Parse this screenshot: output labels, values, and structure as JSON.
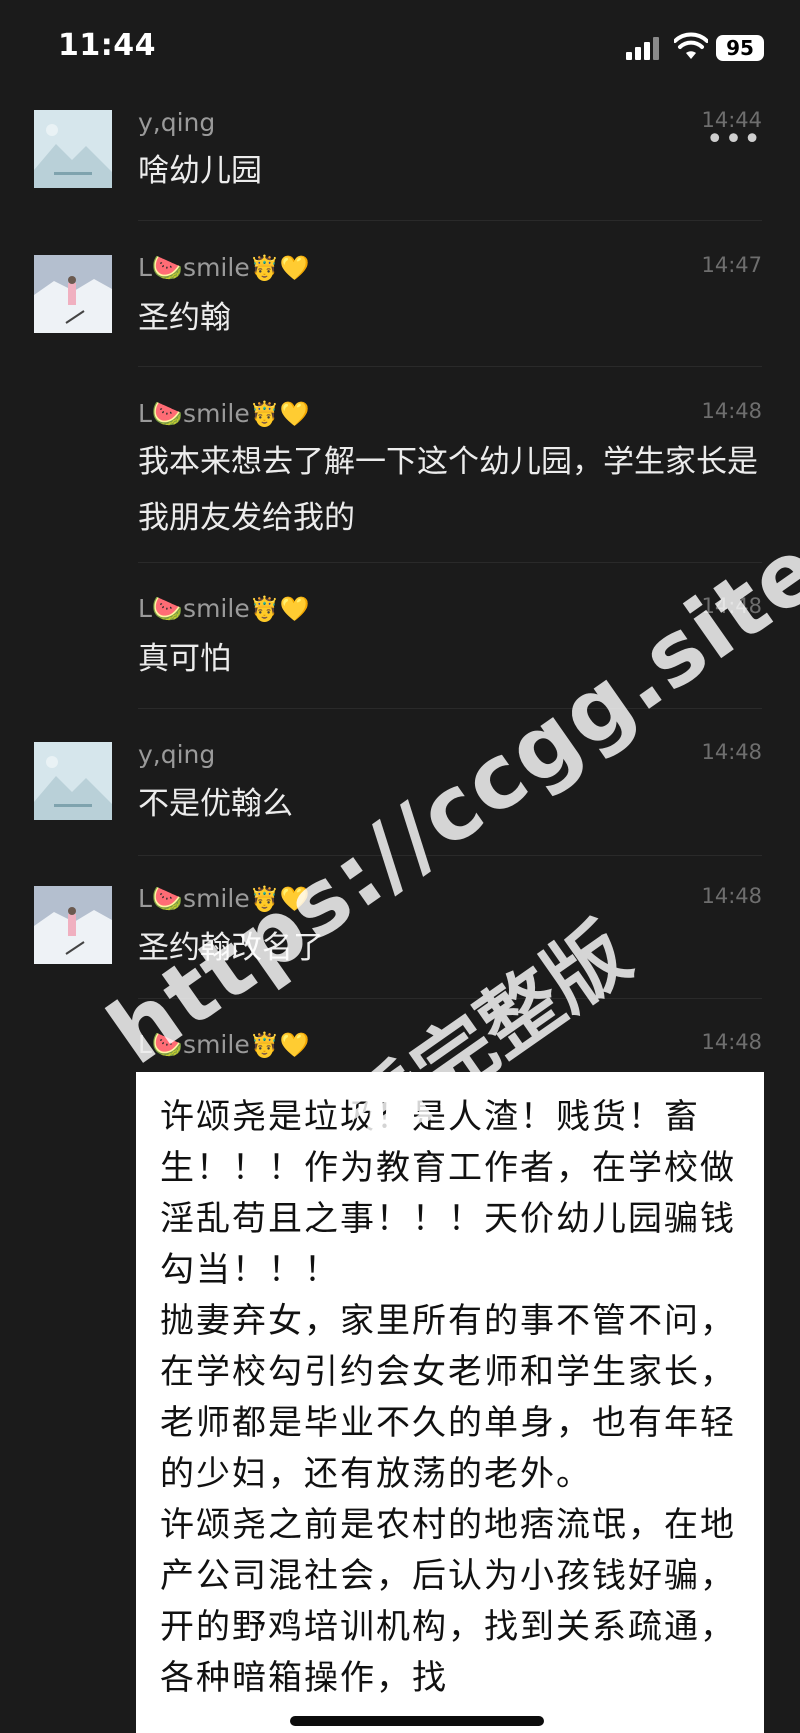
{
  "status_bar": {
    "time": "11:44",
    "battery": "95"
  },
  "messages": [
    {
      "sender": "y,qing",
      "time": "14:44",
      "text": "啥幼儿园",
      "more": "•••"
    },
    {
      "sender_name": "L🍉smile",
      "badges": "🤴💛",
      "time": "14:47",
      "text": "圣约翰"
    },
    {
      "sender_name": "L🍉smile",
      "badges": "🤴💛",
      "time": "14:48",
      "text": "我本来想去了解一下这个幼儿园，学生家长是我朋友发给我的"
    },
    {
      "sender_name": "L🍉smile",
      "badges": "🤴💛",
      "time": "14:48",
      "text": "真可怕"
    },
    {
      "sender": "y,qing",
      "time": "14:48",
      "text": "不是优翰么"
    },
    {
      "sender_name": "L🍉smile",
      "badges": "🤴💛",
      "time": "14:48",
      "text": "圣约翰改名了"
    },
    {
      "sender_name": "L🍉smile",
      "badges": "🤴💛",
      "time": "14:48"
    }
  ],
  "image_text": "许颂尧是垃圾！是人渣！贱货！畜生！！！作为教育工作者，在学校做淫乱苟且之事！！！天价幼儿园骗钱勾当！！！\n抛妻弃女，家里所有的事不管不问，在学校勾引约会女老师和学生家长，老师都是毕业不久的单身，也有年轻的少妇，还有放荡的老外。\n许颂尧之前是农村的地痞流氓，在地产公司混社会，后认为小孩钱好骗，开的野鸡培训机构，找到关系疏通，各种暗箱操作，找",
  "watermark": {
    "line1": "https://ccgg.site",
    "line2": "看完整版"
  },
  "colors": {
    "background": "#1b1b1b",
    "text": "#ececec",
    "meta": "#9a9a9a",
    "card": "#ffffff"
  }
}
